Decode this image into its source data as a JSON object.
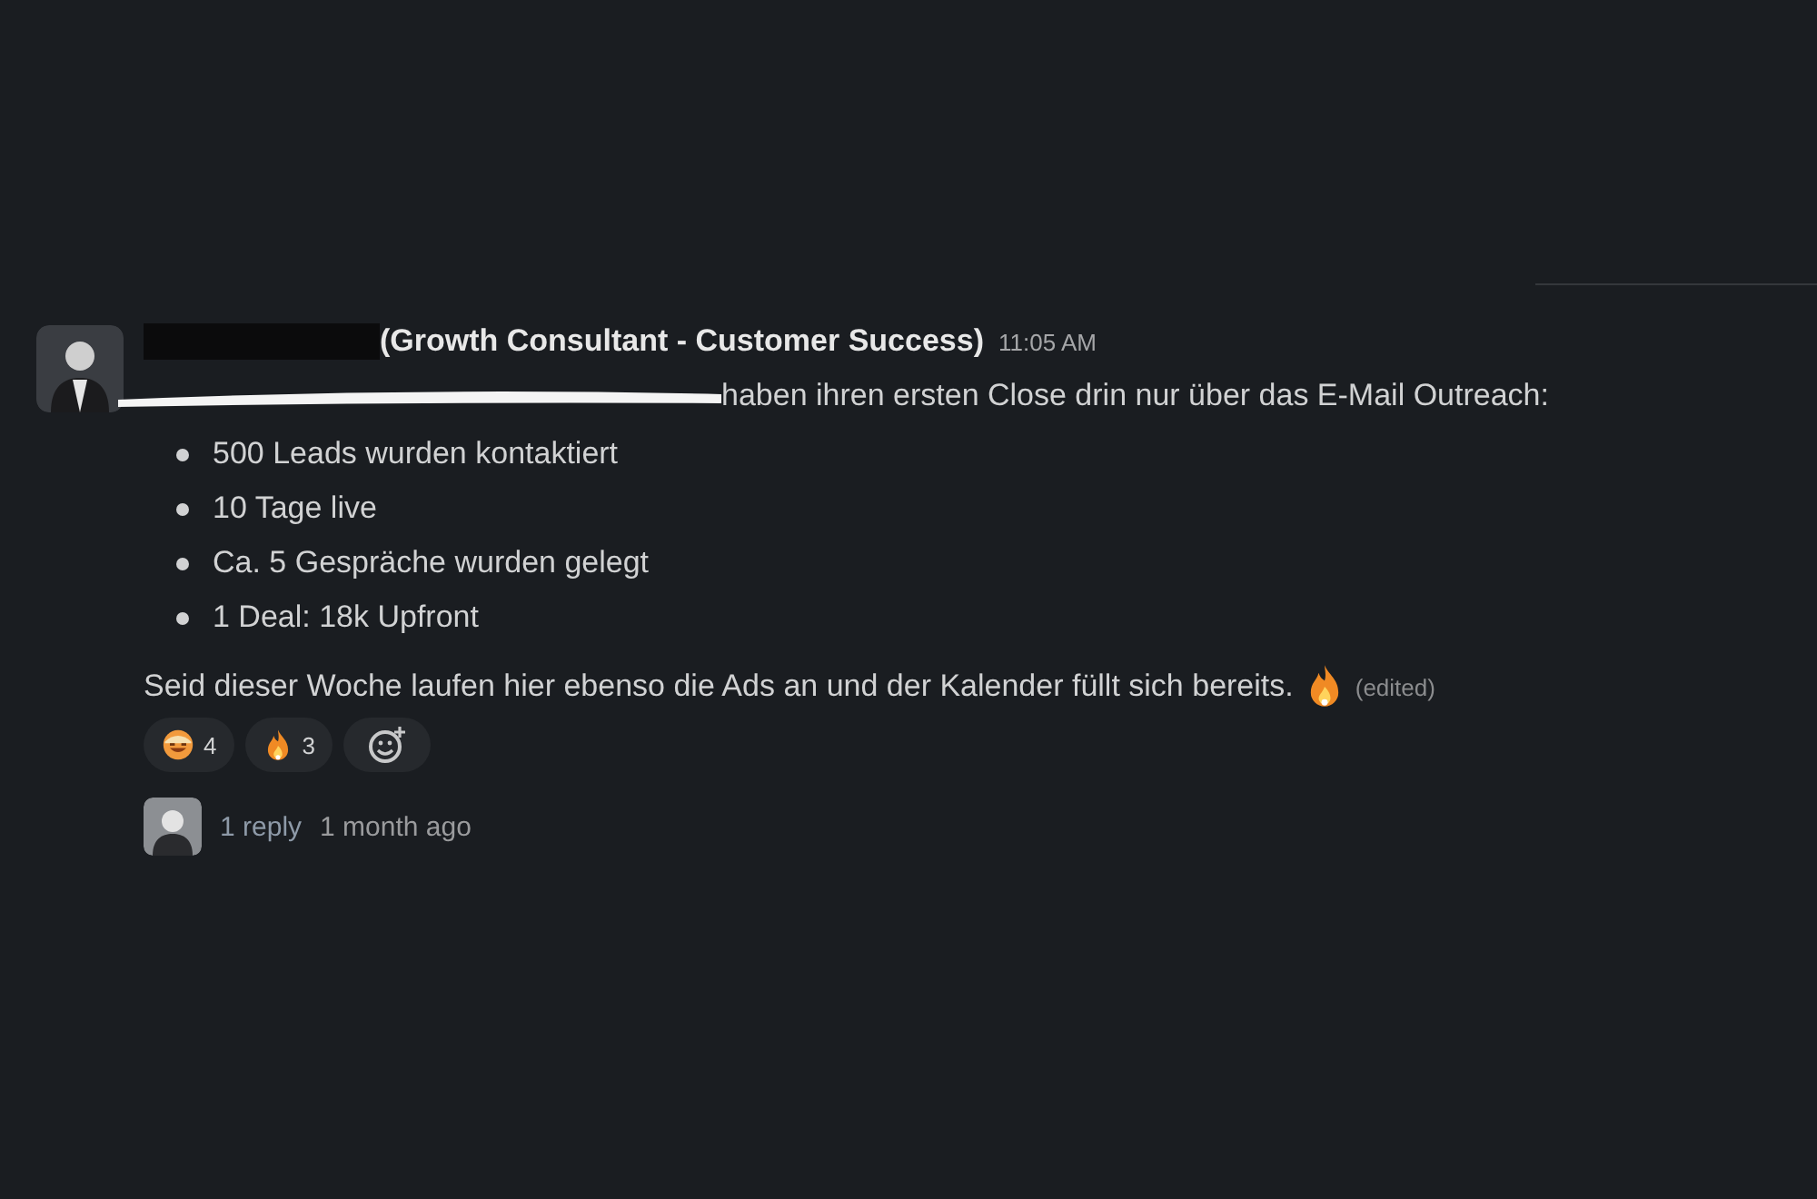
{
  "message": {
    "author_title": "(Growth Consultant - Customer Success)",
    "time": "11:05 AM",
    "intro": "haben ihren ersten Close drin nur über das E-Mail Outreach:",
    "bullets": [
      "500 Leads wurden kontaktiert",
      "10 Tage live",
      "Ca. 5 Gespräche wurden gelegt",
      "1 Deal: 18k Upfront"
    ],
    "closing": "Seid dieser Woche laufen hier ebenso die Ads an und der Kalender füllt sich bereits.",
    "edited": "(edited)",
    "reactions": [
      {
        "kind": "grin",
        "count": "4"
      },
      {
        "kind": "fire",
        "count": "3"
      }
    ],
    "thread": {
      "replies": "1 reply",
      "age": "1 month ago"
    }
  }
}
